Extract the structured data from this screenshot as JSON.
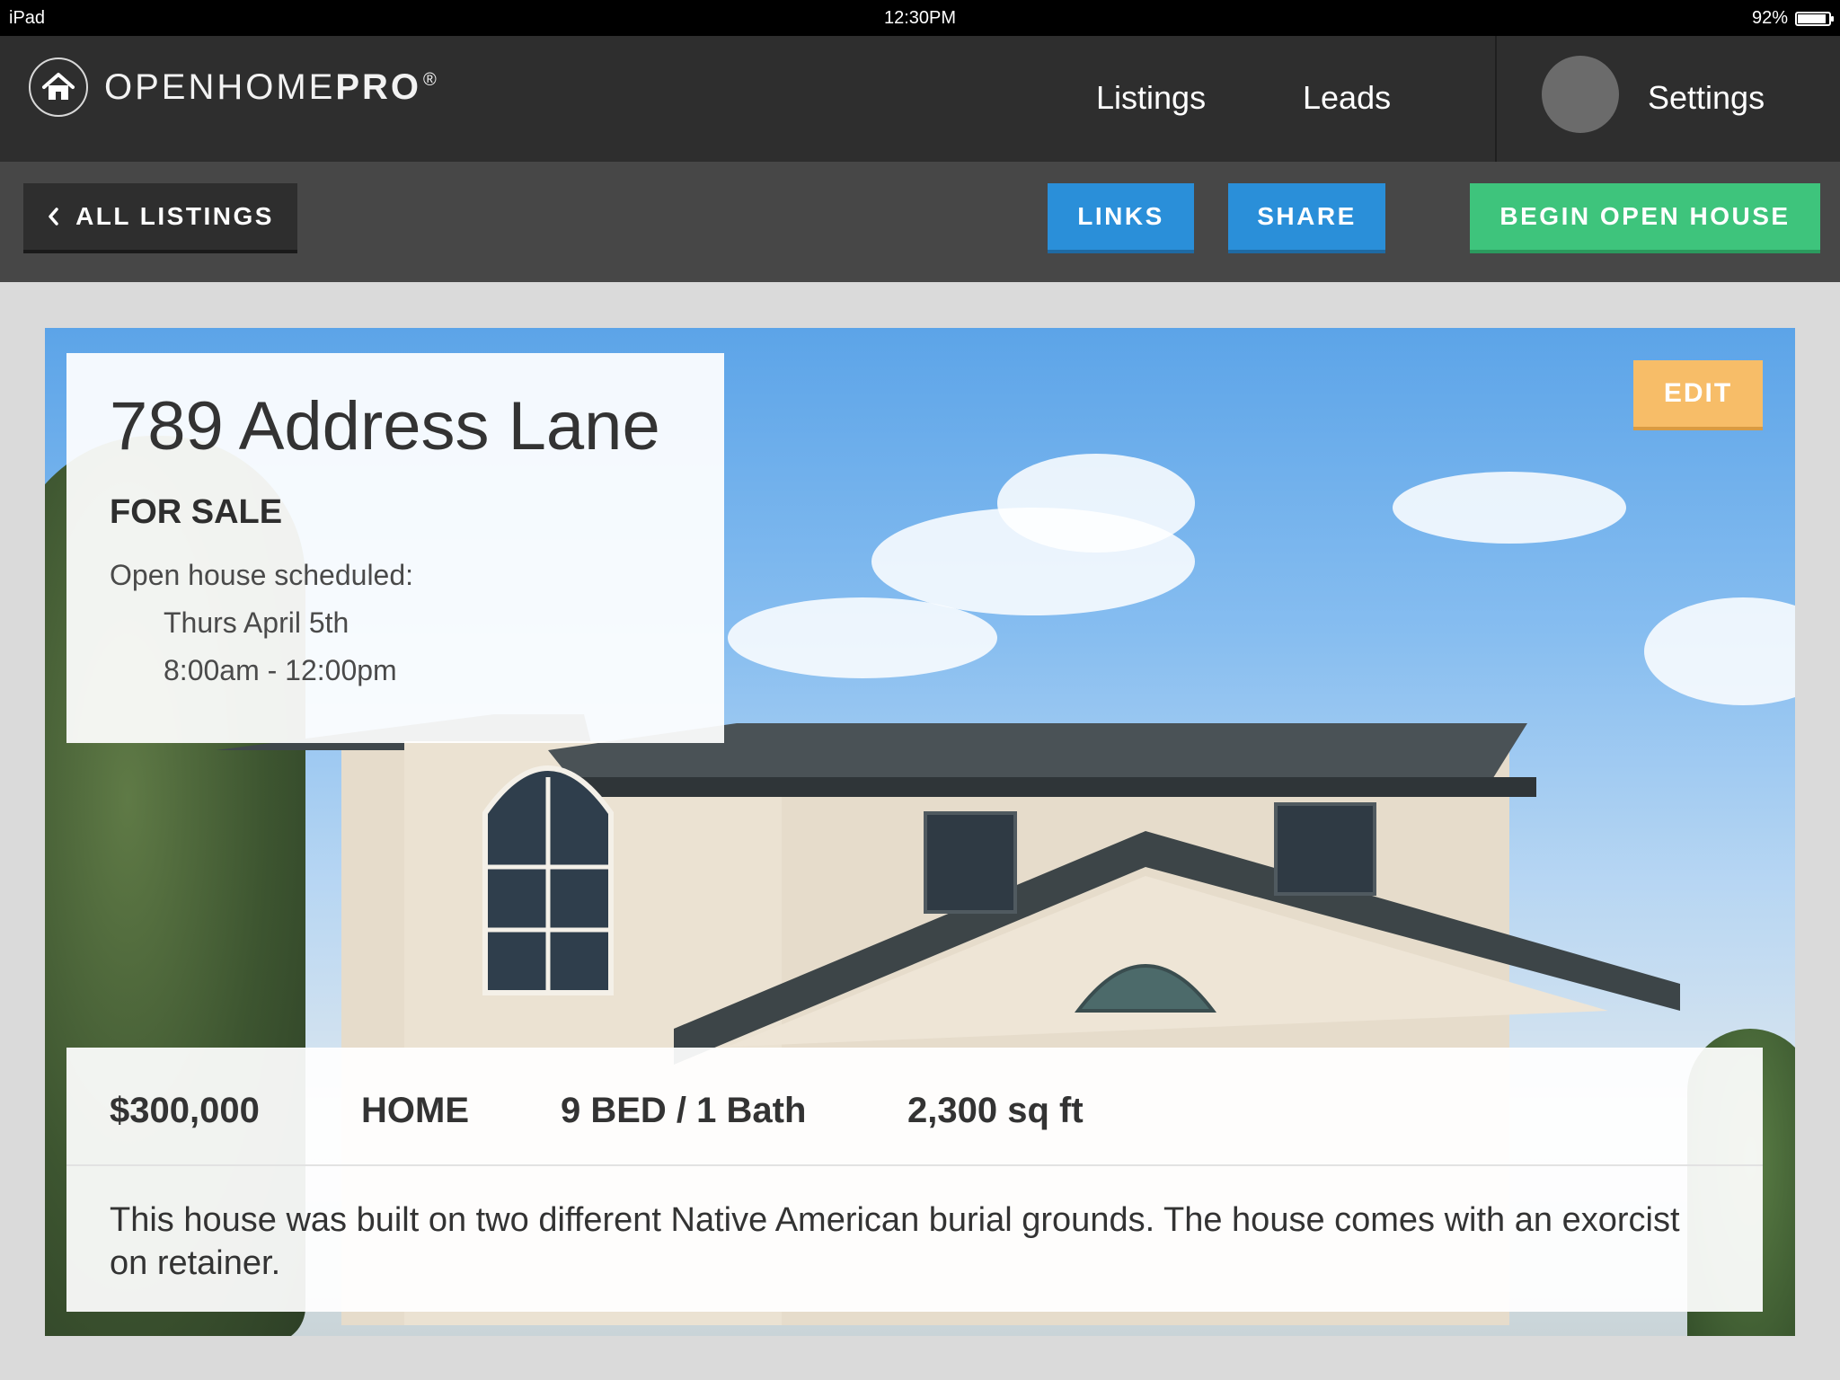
{
  "status_bar": {
    "device": "iPad",
    "time": "12:30PM",
    "battery": "92%",
    "battery_level": 0.92
  },
  "nav": {
    "brand_light": "OPENHOME",
    "brand_bold": "PRO",
    "brand_mark": "®",
    "listings": "Listings",
    "leads": "Leads",
    "settings": "Settings"
  },
  "toolbar": {
    "back": "ALL LISTINGS",
    "links": "LINKS",
    "share": "SHARE",
    "begin": "BEGIN OPEN HOUSE"
  },
  "listing": {
    "edit": "EDIT",
    "address": "789 Address Lane",
    "status": "FOR SALE",
    "open_house_label": "Open house scheduled:",
    "open_house_date": "Thurs April 5th",
    "open_house_time": "8:00am - 12:00pm",
    "price": "$300,000",
    "type": "HOME",
    "beds_baths": "9 BED / 1 Bath",
    "sqft": "2,300 sq ft",
    "description": "This house was built on two different Native American burial grounds. The house comes with an exorcist on retainer."
  },
  "colors": {
    "nav_bg": "#2e2e2e",
    "toolbar_bg": "#474747",
    "blue_button": "#2a8fd9",
    "green_button": "#3ec47c",
    "edit_button": "#f7bd68"
  },
  "icons": [
    "home-logo-icon",
    "chevron-left-icon",
    "battery-icon"
  ]
}
